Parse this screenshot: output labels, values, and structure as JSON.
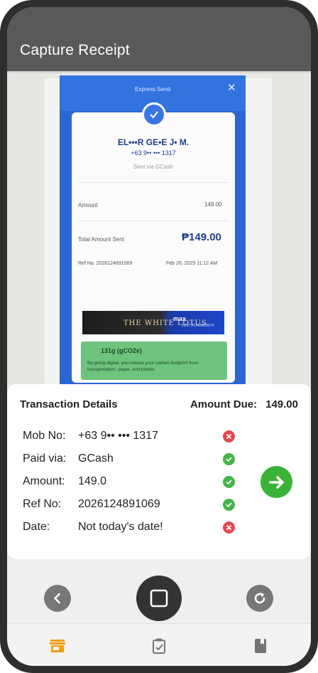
{
  "app": {
    "title": "Capture Receipt"
  },
  "preview": {
    "header": "Express Send",
    "close": "✕",
    "recipient_name": "EL•••R GE•E J• M.",
    "recipient_mobile": "+63 9•• ••• 1317",
    "sent_via": "Sent via GCash",
    "amount_label": "Amount",
    "amount_value": "149.00",
    "total_label": "Total Amount Sent",
    "total_value": "₱149.00",
    "ref_label": "Ref No. 2026124891069",
    "date_value": "Feb 26, 2025 11:12 AM",
    "banner_text": "THE WHITE LOTUS",
    "banner_brand": "max",
    "banner_sub": "JUST ₱149/MONTH",
    "carbon_value": "131g (gCO2e)",
    "carbon_text": "By going digital, you reduce your carbon footprint from transportation, paper, and plastic."
  },
  "details": {
    "title": "Transaction Details",
    "amount_due_label": "Amount Due:",
    "amount_due_value": "149.00",
    "rows": [
      {
        "label": "Mob No:",
        "value": "+63 9•• ••• 1317",
        "status": "invalid"
      },
      {
        "label": "Paid via:",
        "value": "GCash",
        "status": "valid"
      },
      {
        "label": "Amount:",
        "value": "149.0",
        "status": "valid"
      },
      {
        "label": "Ref No:",
        "value": "2026124891069",
        "status": "valid"
      },
      {
        "label": "Date:",
        "value": "Not today's date!",
        "status": "invalid"
      }
    ]
  },
  "controls": [
    "back-icon",
    "capture-icon",
    "refresh-icon"
  ],
  "bottom_nav": [
    {
      "icon": "store-icon",
      "active": true
    },
    {
      "icon": "clipboard-check-icon",
      "active": false
    },
    {
      "icon": "book-icon",
      "active": false
    }
  ],
  "colors": {
    "appbar": "#595959",
    "valid": "#44b54a",
    "invalid": "#e24b50",
    "next": "#3ab237",
    "nav_active": "#f39c12",
    "nav_inactive": "#757575"
  }
}
